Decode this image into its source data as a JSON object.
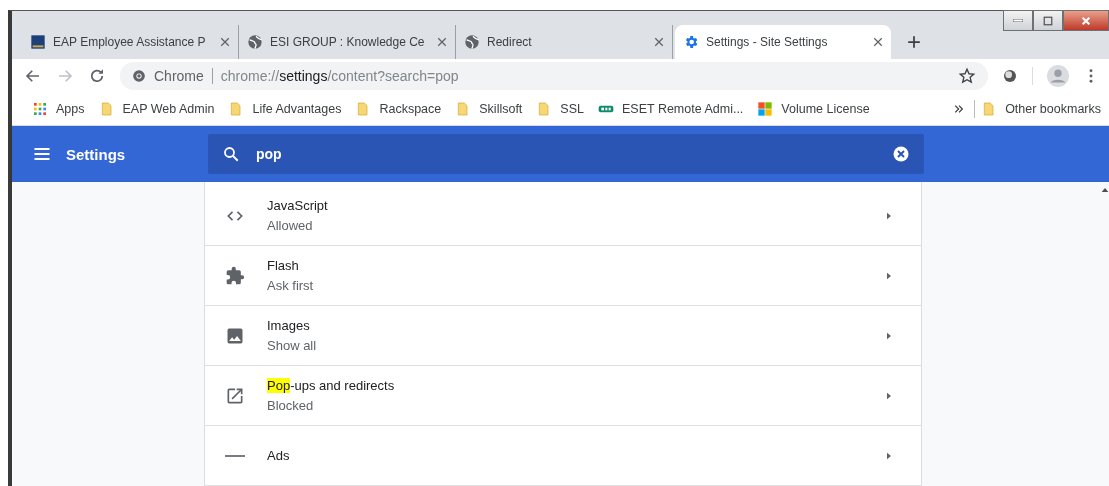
{
  "tabs": [
    {
      "title": "EAP Employee Assistance P",
      "kind": "logo",
      "selected": false
    },
    {
      "title": "ESI GROUP : Knowledge Ce",
      "kind": "globe",
      "selected": false
    },
    {
      "title": "Redirect",
      "kind": "globe",
      "selected": false
    },
    {
      "title": "Settings - Site Settings",
      "kind": "gear",
      "selected": true
    }
  ],
  "omnibox": {
    "site": "Chrome",
    "url_prefix": "chrome://",
    "url_host": "settings",
    "url_rest": "/content?search=pop"
  },
  "bookmarks": [
    {
      "label": "Apps",
      "kind": "apps"
    },
    {
      "label": "EAP Web Admin",
      "kind": "folder"
    },
    {
      "label": "Life Advantages",
      "kind": "folder"
    },
    {
      "label": "Rackspace",
      "kind": "folder"
    },
    {
      "label": "Skillsoft",
      "kind": "folder"
    },
    {
      "label": "SSL",
      "kind": "folder"
    },
    {
      "label": "ESET Remote Admi...",
      "kind": "eset"
    },
    {
      "label": "Volume License",
      "kind": "ms"
    }
  ],
  "other_bookmarks": "Other bookmarks",
  "header": {
    "title": "Settings",
    "search_value": "pop"
  },
  "items": [
    {
      "kind": "code",
      "title": [
        {
          "text": "JavaScript",
          "highlighted": false
        }
      ],
      "subtitle": "Allowed"
    },
    {
      "kind": "puzzle",
      "title": [
        {
          "text": "Flash",
          "highlighted": false
        }
      ],
      "subtitle": "Ask first"
    },
    {
      "kind": "image",
      "title": [
        {
          "text": "Images",
          "highlighted": false
        }
      ],
      "subtitle": "Show all"
    },
    {
      "kind": "open",
      "title": [
        {
          "text": "Pop",
          "highlighted": true
        },
        {
          "text": "-ups and redirects",
          "highlighted": false
        }
      ],
      "subtitle": "Blocked"
    },
    {
      "kind": "ads",
      "title": [
        {
          "text": "Ads",
          "highlighted": false
        }
      ]
    }
  ]
}
